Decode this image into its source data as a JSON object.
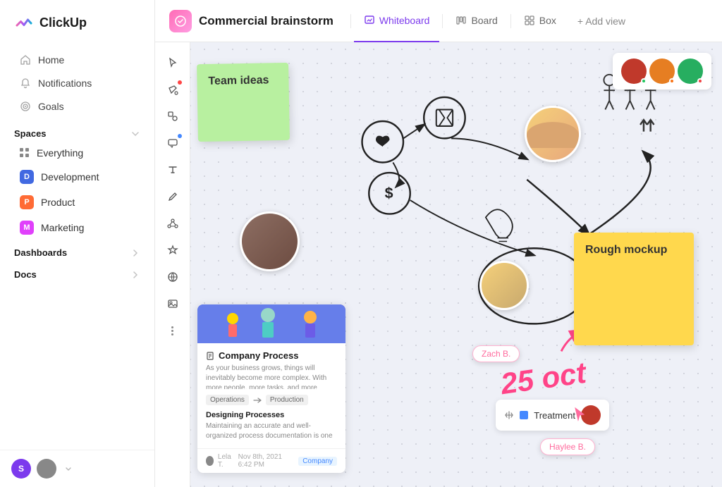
{
  "app": {
    "name": "ClickUp"
  },
  "sidebar": {
    "nav_items": [
      {
        "id": "home",
        "label": "Home",
        "icon": "home-icon"
      },
      {
        "id": "notifications",
        "label": "Notifications",
        "icon": "bell-icon"
      },
      {
        "id": "goals",
        "label": "Goals",
        "icon": "target-icon"
      }
    ],
    "spaces_label": "Spaces",
    "everything_label": "Everything",
    "spaces": [
      {
        "id": "development",
        "label": "Development",
        "badge": "D",
        "badge_class": "badge-d"
      },
      {
        "id": "product",
        "label": "Product",
        "badge": "P",
        "badge_class": "badge-p"
      },
      {
        "id": "marketing",
        "label": "Marketing",
        "badge": "M",
        "badge_class": "badge-m"
      }
    ],
    "dashboards_label": "Dashboards",
    "docs_label": "Docs",
    "user_initial": "S"
  },
  "topbar": {
    "project_title": "Commercial brainstorm",
    "tabs": [
      {
        "id": "whiteboard",
        "label": "Whiteboard",
        "active": true
      },
      {
        "id": "board",
        "label": "Board",
        "active": false
      },
      {
        "id": "box",
        "label": "Box",
        "active": false
      }
    ],
    "add_view_label": "+ Add view"
  },
  "canvas": {
    "sticky_notes": [
      {
        "id": "team-ideas",
        "text": "Team ideas",
        "color": "green"
      },
      {
        "id": "rough-mockup",
        "text": "Rough mockup",
        "color": "yellow"
      }
    ],
    "document_card": {
      "title": "Company Process",
      "description": "As your business grows, things will inevitably become more complex. With more people, more tasks, and more steps, business processes need to be arranged and mandated in the most efficient way possible to continue growth.",
      "flow_from": "Operations",
      "flow_to": "Production",
      "section_title": "Designing Processes",
      "section_desc": "Maintaining an accurate and well-organized process documentation is one of the most effective ways to improve your company.",
      "footer_text": "Nov 8th, 2021 6:42 PM",
      "footer_tag": "Company"
    },
    "name_tags": [
      {
        "id": "zach",
        "label": "Zach B."
      },
      {
        "id": "haylee",
        "label": "Haylee B."
      }
    ],
    "treatment_card": {
      "label": "Treatment"
    },
    "date_text": "25 oct"
  },
  "toolbar_tools": [
    {
      "id": "cursor",
      "icon": "cursor-icon"
    },
    {
      "id": "paint",
      "icon": "paint-icon",
      "dot": "red"
    },
    {
      "id": "shapes",
      "icon": "shapes-icon"
    },
    {
      "id": "comment",
      "icon": "comment-icon",
      "dot": "blue"
    },
    {
      "id": "text",
      "icon": "text-icon"
    },
    {
      "id": "pen",
      "icon": "pen-icon"
    },
    {
      "id": "network",
      "icon": "network-icon"
    },
    {
      "id": "ai",
      "icon": "ai-icon"
    },
    {
      "id": "globe",
      "icon": "globe-icon"
    },
    {
      "id": "image",
      "icon": "image-icon"
    },
    {
      "id": "more",
      "icon": "more-icon"
    }
  ]
}
